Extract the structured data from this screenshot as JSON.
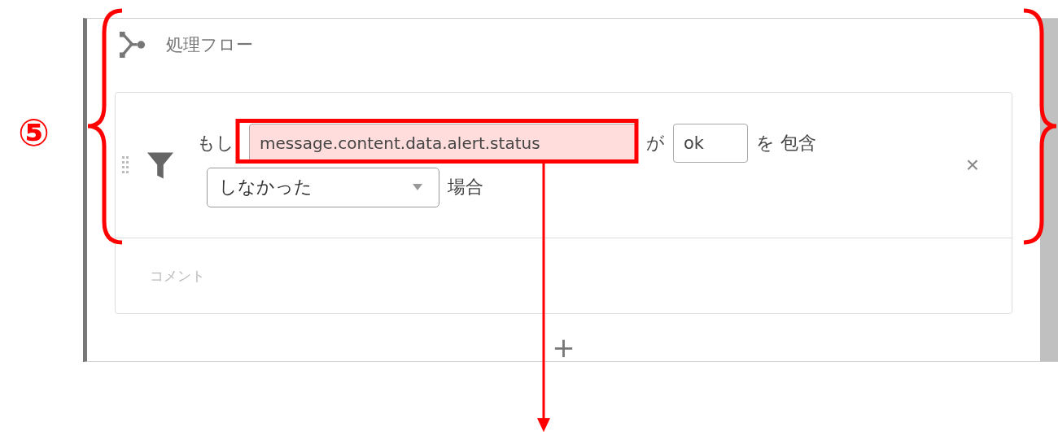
{
  "panel": {
    "title": "処理フロー"
  },
  "condition": {
    "prefix": "もし",
    "field": {
      "value": "message.content.data.alert.status",
      "highlighted": true
    },
    "particle": "が",
    "match_value": {
      "value": "ok"
    },
    "operator": "を 包含",
    "negation": {
      "value": "しなかった"
    },
    "suffix": "場合",
    "remove": "×"
  },
  "comment": {
    "placeholder": "コメント"
  },
  "add": "+",
  "annotation": {
    "number_label": "⑤"
  }
}
